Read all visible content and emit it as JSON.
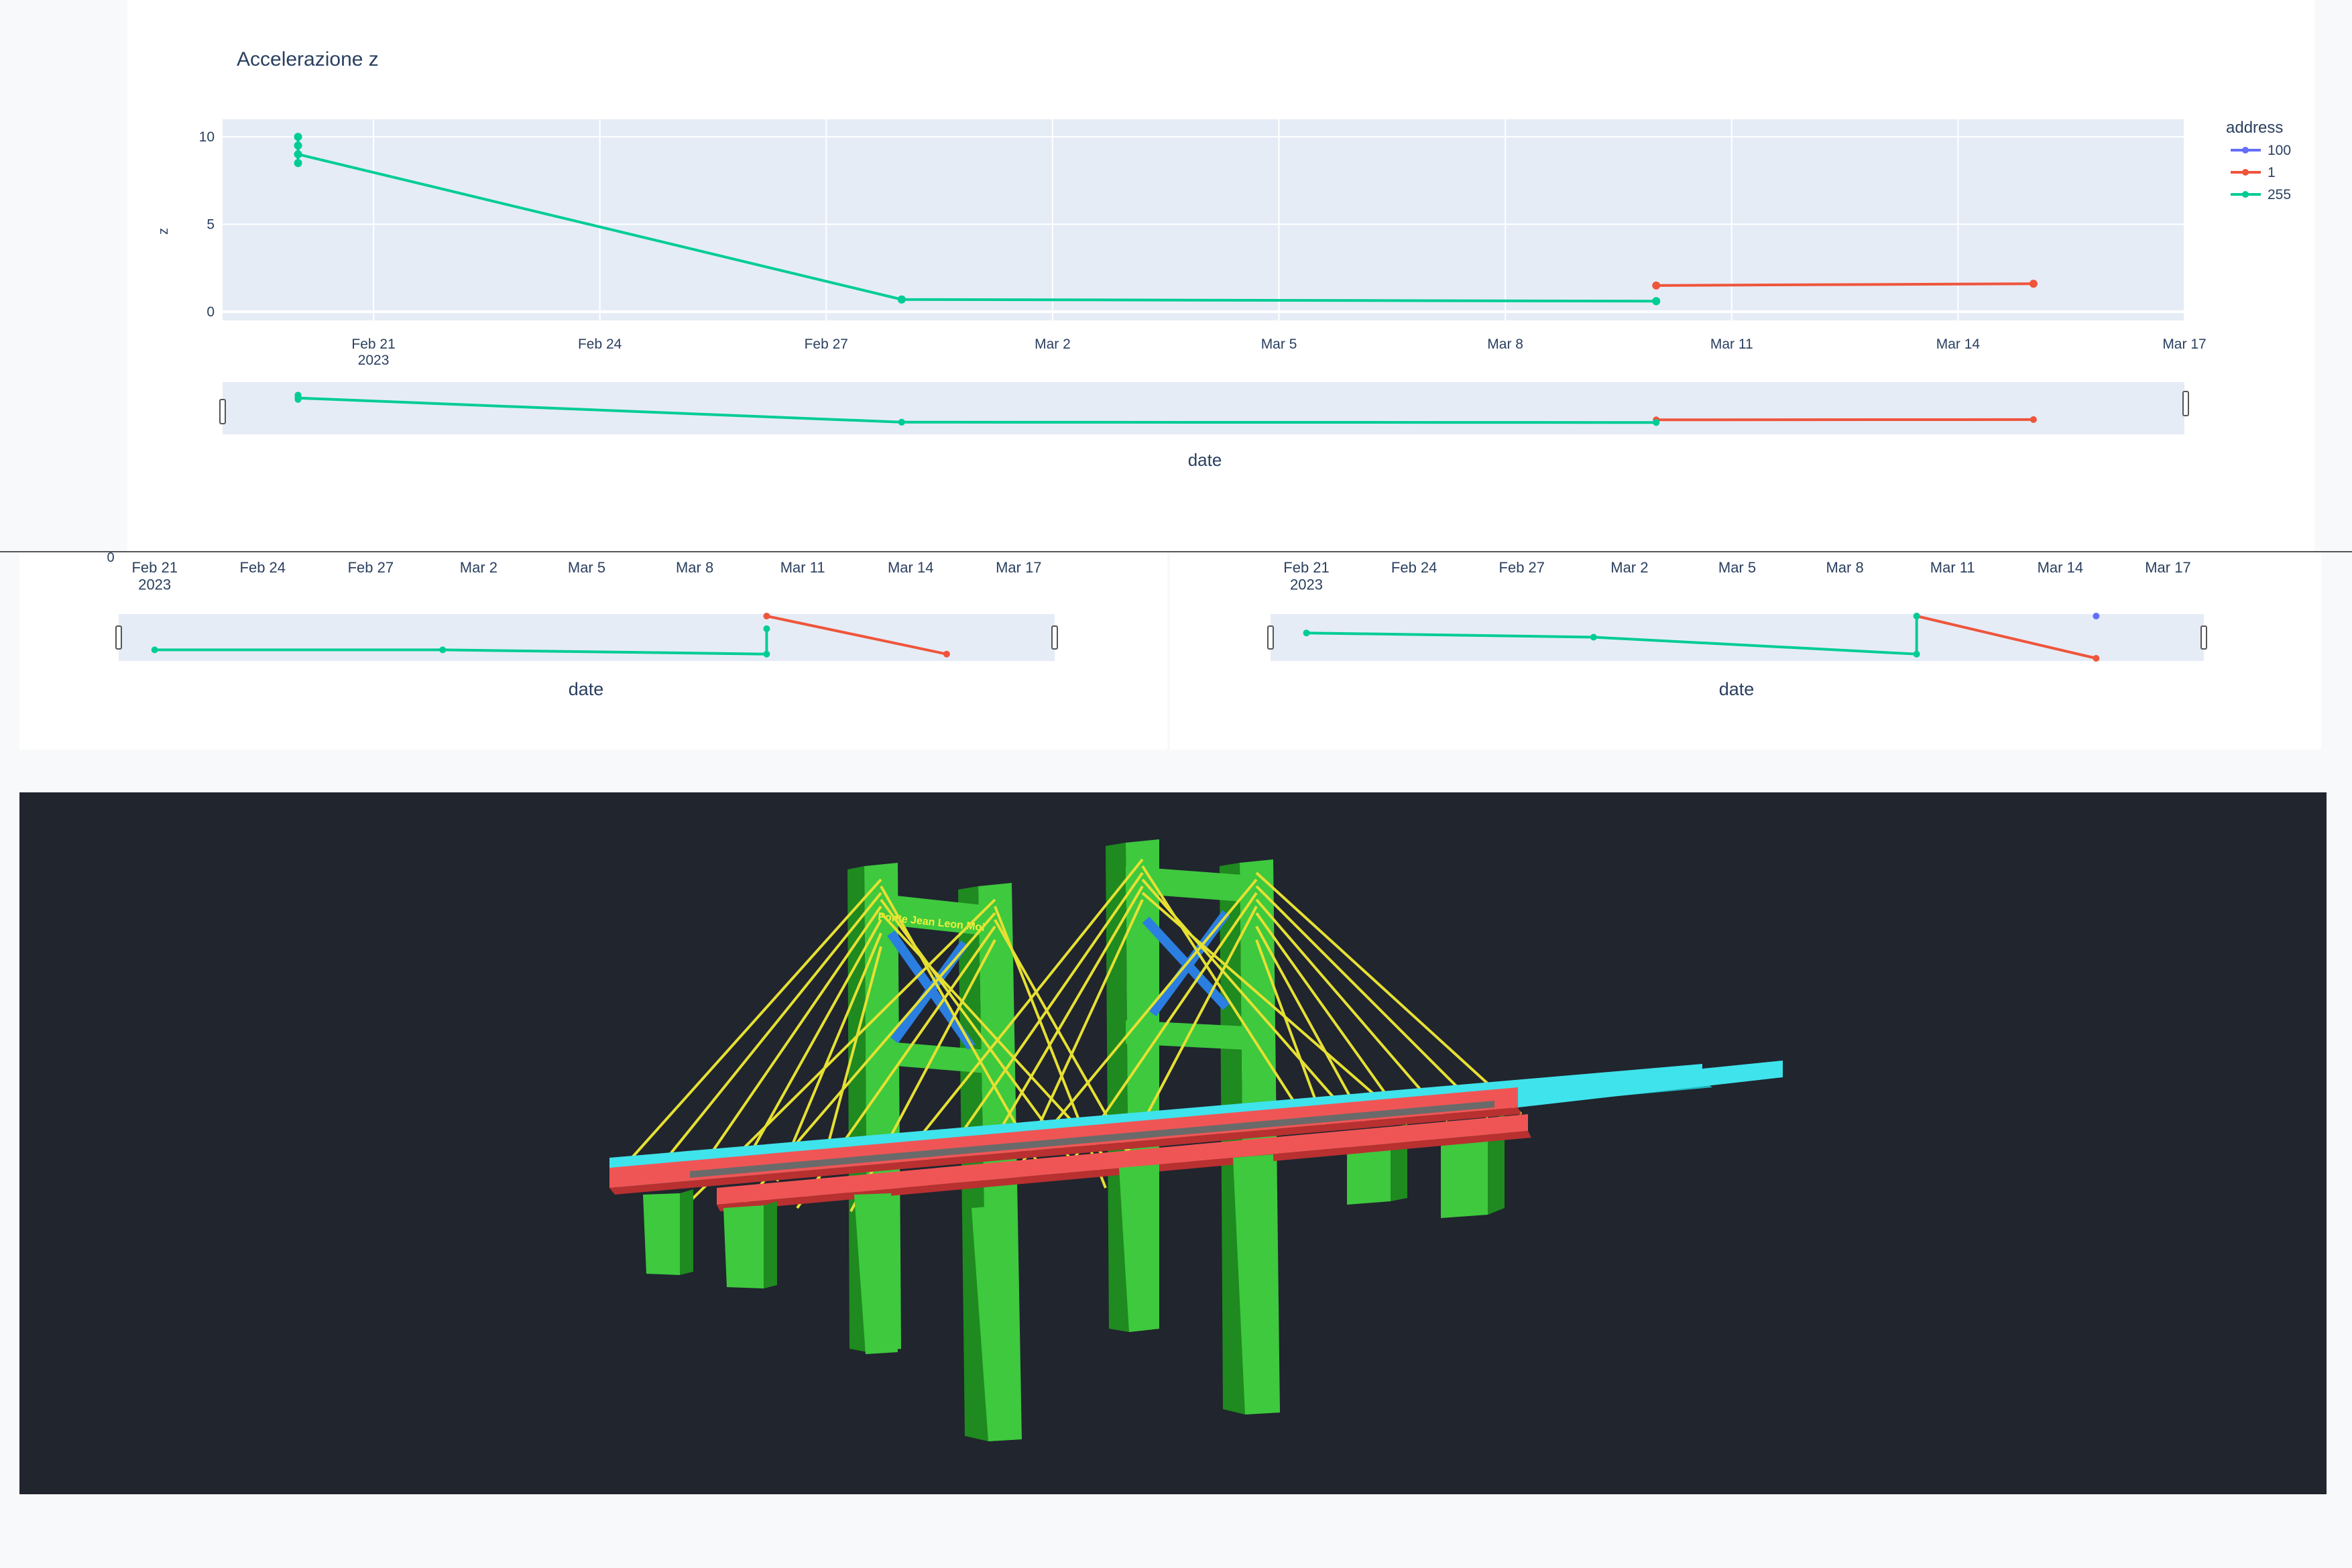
{
  "main_chart": {
    "title": "Accelerazione z",
    "y_label": "z",
    "x_label": "date",
    "legend": {
      "title": "address",
      "entries": [
        {
          "name": "100",
          "color": "#636efa"
        },
        {
          "name": "1",
          "color": "#ef553b"
        },
        {
          "name": "255",
          "color": "#00cc96"
        }
      ]
    }
  },
  "lower_left_chart": {
    "x_label": "date"
  },
  "lower_right_chart": {
    "x_label": "date"
  },
  "bridge_viewer": {
    "sign_text": "Ponte Jean Leon Moi",
    "colors": {
      "background": "#20252e",
      "pylon": "#3ec93e",
      "cable": "#e6e033",
      "deck_red": "#f05555",
      "deck_cyan": "#3fe3ec",
      "bracing": "#2b7fe0"
    }
  },
  "chart_data": [
    {
      "type": "line",
      "title": "Accelerazione z",
      "xlabel": "date",
      "ylabel": "z",
      "x_ticks": [
        "Feb 21\n2023",
        "Feb 24",
        "Feb 27",
        "Mar 2",
        "Mar 5",
        "Mar 8",
        "Mar 11",
        "Mar 14",
        "Mar 17"
      ],
      "y_ticks": [
        0,
        5,
        10
      ],
      "ylim": [
        -0.5,
        11
      ],
      "xlim": [
        "2023-02-19",
        "2023-03-17"
      ],
      "grid": true,
      "legend_title": "address",
      "legend_position": "right",
      "has_range_slider": true,
      "series": [
        {
          "name": "100",
          "color": "#636efa",
          "x": [],
          "y": []
        },
        {
          "name": "1",
          "color": "#ef553b",
          "x": [
            "2023-03-10",
            "2023-03-15"
          ],
          "y": [
            1.5,
            1.6
          ]
        },
        {
          "name": "255",
          "color": "#00cc96",
          "x": [
            "2023-02-20",
            "2023-02-20",
            "2023-02-20",
            "2023-02-20",
            "2023-02-28",
            "2023-02-28",
            "2023-03-10",
            "2023-03-10"
          ],
          "y": [
            10,
            9.5,
            8.5,
            9,
            0.7,
            0.7,
            0.6,
            0.6
          ]
        }
      ]
    },
    {
      "type": "line",
      "xlabel": "date",
      "x_ticks": [
        "Feb 21\n2023",
        "Feb 24",
        "Feb 27",
        "Mar 2",
        "Mar 5",
        "Mar 8",
        "Mar 11",
        "Mar 14",
        "Mar 17"
      ],
      "y_ticks": [
        0
      ],
      "xlim": [
        "2023-02-20",
        "2023-03-18"
      ],
      "has_range_slider": true,
      "series": [
        {
          "name": "1",
          "color": "#ef553b",
          "x": [
            "2023-03-10",
            "2023-03-15"
          ],
          "y": [
            1.0,
            0.1
          ]
        },
        {
          "name": "255",
          "color": "#00cc96",
          "x": [
            "2023-02-21",
            "2023-03-01",
            "2023-03-10",
            "2023-03-10"
          ],
          "y": [
            0.2,
            0.2,
            0.1,
            0.7
          ]
        }
      ]
    },
    {
      "type": "line",
      "xlabel": "date",
      "x_ticks": [
        "Feb 21\n2023",
        "Feb 24",
        "Feb 27",
        "Mar 2",
        "Mar 5",
        "Mar 8",
        "Mar 11",
        "Mar 14",
        "Mar 17"
      ],
      "xlim": [
        "2023-02-20",
        "2023-03-18"
      ],
      "has_range_slider": true,
      "series": [
        {
          "name": "100",
          "color": "#636efa",
          "x": [
            "2023-03-15"
          ],
          "y": [
            1.0
          ]
        },
        {
          "name": "1",
          "color": "#ef553b",
          "x": [
            "2023-03-10",
            "2023-03-15"
          ],
          "y": [
            1.0,
            0.0
          ]
        },
        {
          "name": "255",
          "color": "#00cc96",
          "x": [
            "2023-02-21",
            "2023-03-01",
            "2023-03-10",
            "2023-03-10"
          ],
          "y": [
            0.6,
            0.5,
            0.1,
            1.0
          ]
        }
      ]
    }
  ]
}
